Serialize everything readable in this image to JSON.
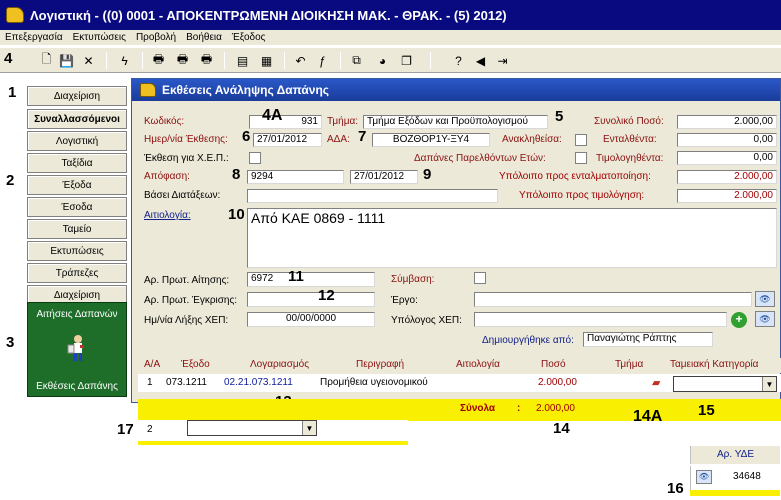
{
  "window": {
    "title": "Λογιστική - ((0) 0001 - ΑΠΟΚΕΝΤΡΩΜΕΝΗ ΔΙΟΙΚΗΣΗ  ΜΑΚ. - ΘΡΑΚ. - (5) 2012)"
  },
  "menu": [
    "Επεξεργασία",
    "Εκτυπώσεις",
    "Προβολή",
    "Βοήθεια",
    "Έξοδος"
  ],
  "annotations": {
    "a1": "1",
    "a2": "2",
    "a3": "3",
    "a4": "4",
    "a4A": "4A",
    "a5": "5",
    "a6": "6",
    "a7": "7",
    "a8": "8",
    "a9": "9",
    "a10": "10",
    "a11": "11",
    "a12": "12",
    "a13": "13",
    "a14": "14",
    "a14A": "14A",
    "a15": "15",
    "a16": "16",
    "a17": "17"
  },
  "sidebar": {
    "items": [
      "Διαχείριση",
      "Συναλλασσόμενοι",
      "Λογιστική",
      "Ταξίδια",
      "Έξοδα",
      "Έσοδα",
      "Ταμείο",
      "Εκτυπώσεις",
      "Τράπεζες",
      "Διαχείριση"
    ],
    "big_button_top": "Αιτήσεις Δαπανών",
    "big_button_bottom": "Εκθέσεις Δαπάνης"
  },
  "form": {
    "title": "Εκθέσεις Ανάληψης Δαπάνης",
    "kodikos_label": "Κωδικός:",
    "kodikos_value": "931",
    "tmima_label": "Τμήμα:",
    "tmima_value": "Τμήμα Εξόδων και Προϋπολογισμού",
    "synoliko_label": "Συνολικό Ποσό:",
    "synoliko_value": "2.000,00",
    "date_label": "Ημερ/νία Έκθεσης:",
    "date_value": "27/01/2012",
    "ada_label": "ΑΔΑ:",
    "ada_value": "ΒΟΖΘΟΡ1Υ-ΞΥ4",
    "anaklithisa_label": "Ανακληθείσα:",
    "entalthenta_label": "Ενταλθέντα:",
    "entalthenta_value": "0,00",
    "xep_label": "Έκθεση για Χ.Ε.Π.:",
    "dapanes_label": "Δαπάνες Παρελθόντων Ετών:",
    "timologithenta_label": "Τιμολογηθέντα:",
    "timologithenta_value": "0,00",
    "apofasi_label": "Απόφαση:",
    "apofasi_value": "9294",
    "apofasi_date": "27/01/2012",
    "ypoloipo_ent_label": "Υπόλοιπο προς ενταλματοποίηση:",
    "ypoloipo_ent_value": "2.000,00",
    "vasei_label": "Βάσει Διατάξεων:",
    "ypoloipo_tim_label": "Υπόλοιπο προς τιμολόγηση:",
    "ypoloipo_tim_value": "2.000,00",
    "aitiologia_label": "Αιτιολογία:",
    "aitiologia_value": "Από ΚΑΕ 0869 - 1111",
    "ar_aitisis_label": "Αρ. Πρωτ. Αίτησης:",
    "ar_aitisis_value": "6972",
    "symvasi_label": "Σύμβαση:",
    "ar_egkrisis_label": "Αρ. Πρωτ. Έγκρισης:",
    "ergo_label": "Έργο:",
    "lixi_label": "Ημ/νία Λήξης ΧΕΠ:",
    "lixi_value": "00/00/0000",
    "ypologos_label": "Υπόλογος ΧΕΠ:",
    "dimiourgithike_label": "Δημιουργήθηκε από:",
    "dimiourgithike_value": "Παναγιώτης Ράπτης"
  },
  "grid": {
    "headers": [
      "Α/Α",
      "Έξοδο",
      "Λογαριασμός",
      "Περιγραφή",
      "Αιτιολογία",
      "Ποσό",
      "Τμήμα",
      "Ταμειακή Κατηγορία"
    ],
    "row": [
      "1",
      "073.1211",
      "02.21.073.1211",
      "Προμήθεια υγειονομικού",
      "",
      "2.000,00",
      ""
    ],
    "totals_label": "Σύνολα",
    "totals_sep": ":",
    "totals_value": "2.000,00",
    "row2_index": "2"
  },
  "yde": {
    "header": "Αρ. ΥΔΕ",
    "value": "34648"
  }
}
